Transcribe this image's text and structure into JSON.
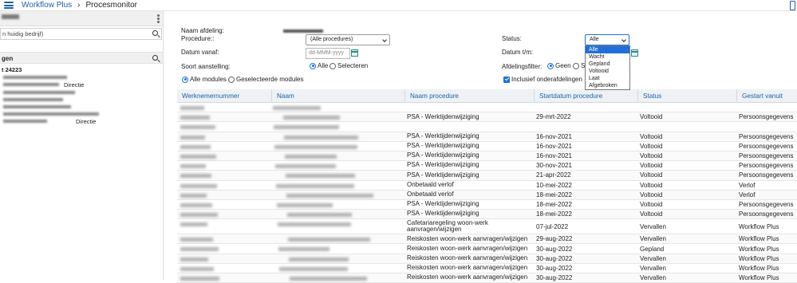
{
  "topbar": {
    "app_title": "Workflow Plus",
    "separator": "›",
    "page_title": "Procesmonitor"
  },
  "left_panel": {
    "search_placeholder": "n huidig bedrijf)",
    "section_label": "gen",
    "tree_items": [
      "t 24223",
      "Directie",
      "Directie"
    ]
  },
  "filters": {
    "naam_afdeling_label": "Naam afdeling:",
    "procedure_label": "Procedure::",
    "procedure_value": "(Alle procedures)",
    "datum_vanaf_label": "Datum vanaf:",
    "datum_vanaf_placeholder": "dd-MMM-yyyy",
    "soort_aanstelling_label": "Soort aanstelling:",
    "soort_options": [
      "Alle",
      "Selecteren"
    ],
    "modules_options": [
      "Alle modules",
      "Geselecteerde modules"
    ],
    "status_label": "Status:",
    "status_value": "Alle",
    "datum_tm_label": "Datum t/m:",
    "afdelingsfilter_label": "Afdelingsfilter:",
    "afdelingsfilter_options": [
      "Geen",
      "S"
    ],
    "inclusief_label": "Inclusief onderafdelingen",
    "status_dropdown_options": [
      "Alle",
      "Wacht",
      "Gepland",
      "Voltooid",
      "Laat",
      "Afgebroken"
    ]
  },
  "table": {
    "columns": [
      "Werknemernummer",
      "Naam",
      "Naam procedure",
      "Startdatum procedure",
      "Status",
      "Gestart vanuit"
    ],
    "rows": [
      {
        "procedure": "",
        "startdatum": "",
        "status": "",
        "gestart": ""
      },
      {
        "procedure": "PSA - Werktijdenwijziging",
        "startdatum": "29-mrt-2022",
        "status": "Voltooid",
        "gestart": "Persoonsgegevens"
      },
      {
        "procedure": "",
        "startdatum": "",
        "status": "",
        "gestart": ""
      },
      {
        "procedure": "PSA - Werktijdenwijziging",
        "startdatum": "16-nov-2021",
        "status": "Voltooid",
        "gestart": "Persoonsgegevens"
      },
      {
        "procedure": "PSA - Werktijdenwijziging",
        "startdatum": "16-nov-2021",
        "status": "Voltooid",
        "gestart": "Persoonsgegevens"
      },
      {
        "procedure": "PSA - Werktijdenwijziging",
        "startdatum": "16-nov-2021",
        "status": "Voltooid",
        "gestart": "Persoonsgegevens"
      },
      {
        "procedure": "PSA - Werktijdenwijziging",
        "startdatum": "30-nov-2021",
        "status": "Voltooid",
        "gestart": "Persoonsgegevens"
      },
      {
        "procedure": "PSA - Werktijdenwijziging",
        "startdatum": "21-apr-2022",
        "status": "Voltooid",
        "gestart": "Persoonsgegevens"
      },
      {
        "procedure": "Onbetaald verlof",
        "startdatum": "10-mei-2022",
        "status": "Voltooid",
        "gestart": "Verlof"
      },
      {
        "procedure": "Onbetaald verlof",
        "startdatum": "18-mei-2022",
        "status": "Voltooid",
        "gestart": "Verlof"
      },
      {
        "procedure": "PSA - Werktijdenwijziging",
        "startdatum": "18-mei-2022",
        "status": "Voltooid",
        "gestart": "Persoonsgegevens"
      },
      {
        "procedure": "PSA - Werktijdenwijziging",
        "startdatum": "18-mei-2022",
        "status": "Voltooid",
        "gestart": "Persoonsgegevens"
      },
      {
        "procedure": "Cafetariaregeling woon-werk aanvragen/wijzigen",
        "startdatum": "07-jul-2022",
        "status": "Vervallen",
        "gestart": "Workflow Plus"
      },
      {
        "procedure": "Reiskosten woon-werk aanvragen/wijzigen",
        "startdatum": "29-aug-2022",
        "status": "Vervallen",
        "gestart": "Workflow Plus"
      },
      {
        "procedure": "Reiskosten woon-werk aanvragen/wijzigen",
        "startdatum": "30-aug-2022",
        "status": "Gepland",
        "gestart": "Workflow Plus"
      },
      {
        "procedure": "Reiskosten woon-werk aanvragen/wijzigen",
        "startdatum": "30-aug-2022",
        "status": "Vervallen",
        "gestart": "Workflow Plus"
      },
      {
        "procedure": "Reiskosten woon-werk aanvragen/wijzigen",
        "startdatum": "30-aug-2022",
        "status": "Vervallen",
        "gestart": "Workflow Plus"
      },
      {
        "procedure": "Reiskosten woon-werk aanvragen/wijzigen",
        "startdatum": "30-aug-2022",
        "status": "Vervallen",
        "gestart": "Workflow Plus"
      }
    ]
  },
  "colors": {
    "accent": "#1f5fa8",
    "selected": "#1e6fd9",
    "header_bg": "#eef2f5"
  }
}
